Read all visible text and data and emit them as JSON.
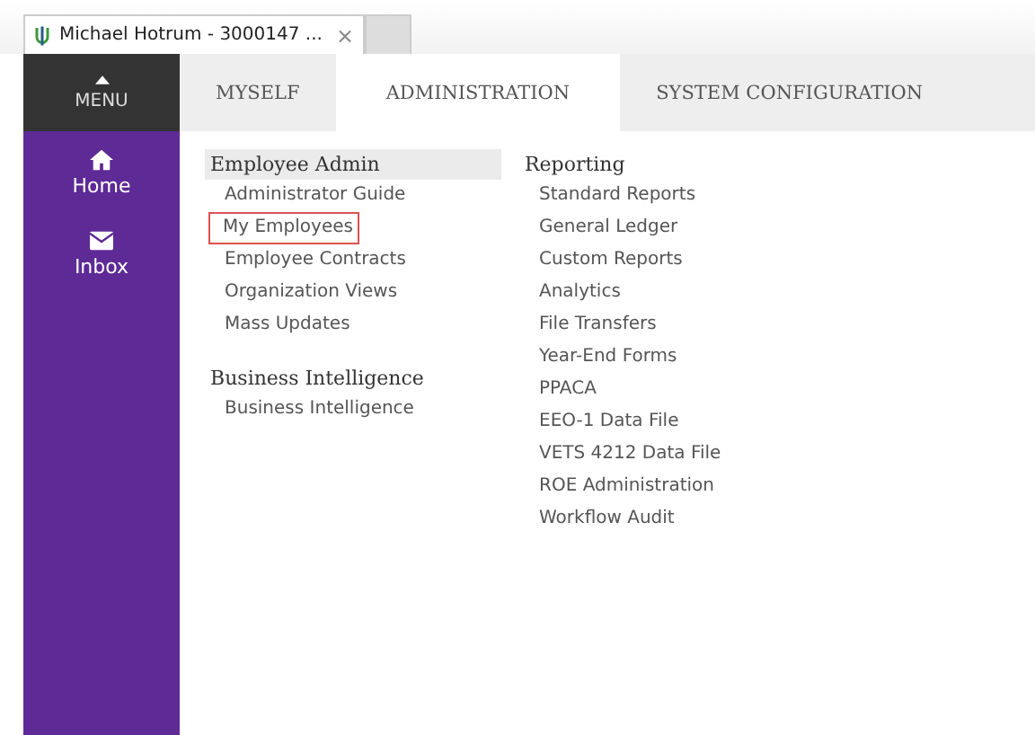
{
  "browser_tab": {
    "title": "Michael Hotrum - 3000147 ...",
    "close": "×"
  },
  "menu_button": {
    "label": "MENU"
  },
  "tabs": [
    {
      "label": "MYSELF",
      "selected": false
    },
    {
      "label": "ADMINISTRATION",
      "selected": true
    },
    {
      "label": "SYSTEM CONFIGURATION",
      "selected": false
    }
  ],
  "sidebar": {
    "items": [
      {
        "label": "Home",
        "kind": "home"
      },
      {
        "label": "Inbox",
        "kind": "inbox"
      }
    ]
  },
  "columns": [
    {
      "sections": [
        {
          "heading": "Employee Admin",
          "highlighted": true,
          "items": [
            {
              "label": "Administrator Guide",
              "outlined": false
            },
            {
              "label": "My Employees",
              "outlined": true
            },
            {
              "label": "Employee Contracts",
              "outlined": false
            },
            {
              "label": "Organization Views",
              "outlined": false
            },
            {
              "label": "Mass Updates",
              "outlined": false
            }
          ]
        },
        {
          "heading": "Business Intelligence",
          "highlighted": false,
          "items": [
            {
              "label": "Business Intelligence",
              "outlined": false
            }
          ]
        }
      ]
    },
    {
      "sections": [
        {
          "heading": "Reporting",
          "highlighted": false,
          "items": [
            {
              "label": "Standard Reports",
              "outlined": false
            },
            {
              "label": "General Ledger",
              "outlined": false
            },
            {
              "label": "Custom Reports",
              "outlined": false
            },
            {
              "label": "Analytics",
              "outlined": false
            },
            {
              "label": "File Transfers",
              "outlined": false
            },
            {
              "label": "Year-End Forms",
              "outlined": false
            },
            {
              "label": "PPACA",
              "outlined": false
            },
            {
              "label": "EEO-1 Data File",
              "outlined": false
            },
            {
              "label": "VETS 4212 Data File",
              "outlined": false
            },
            {
              "label": "ROE Administration",
              "outlined": false
            },
            {
              "label": "Workflow Audit",
              "outlined": false
            }
          ]
        }
      ]
    }
  ]
}
